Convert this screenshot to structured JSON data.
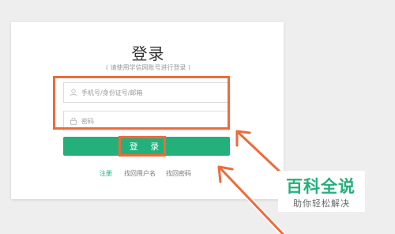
{
  "header": {
    "title": "登录",
    "subtitle": "( 请使用学信网账号进行登录 )"
  },
  "form": {
    "username": {
      "value": "",
      "placeholder": "手机号/身份证号/邮箱",
      "icon": "user-icon"
    },
    "password": {
      "value": "",
      "placeholder": "密码",
      "icon": "lock-icon"
    },
    "submit_label": "登 录"
  },
  "links": {
    "register": "注册",
    "find_username": "找回用户名",
    "find_password": "找回密码"
  },
  "watermark": {
    "main": "百科全说",
    "sub": "助你轻松解决"
  },
  "colors": {
    "accent": "#23b07b",
    "highlight": "#ee6b3b",
    "background": "#eeeeee"
  }
}
